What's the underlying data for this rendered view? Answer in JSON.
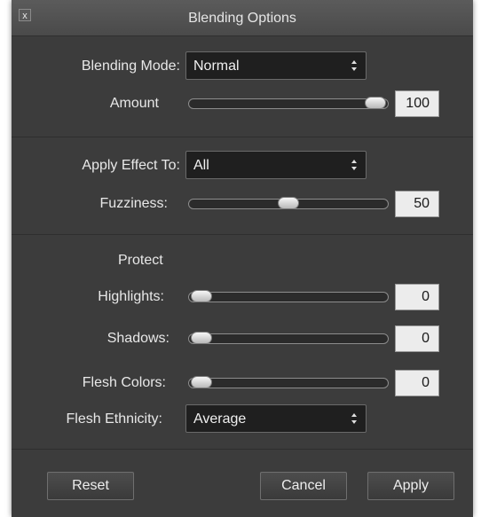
{
  "window": {
    "title": "Blending Options",
    "close_glyph": "x"
  },
  "blending_mode": {
    "label": "Blending Mode:",
    "value": "Normal"
  },
  "amount": {
    "label": "Amount",
    "value": "100",
    "fraction": 1.0
  },
  "apply_effect_to": {
    "label": "Apply Effect To:",
    "value": "All"
  },
  "fuzziness": {
    "label": "Fuzziness:",
    "value": "50",
    "fraction": 0.5
  },
  "protect": {
    "heading": "Protect",
    "highlights": {
      "label": "Highlights:",
      "value": "0",
      "fraction": 0
    },
    "shadows": {
      "label": "Shadows:",
      "value": "0",
      "fraction": 0
    },
    "flesh_colors": {
      "label": "Flesh Colors:",
      "value": "0",
      "fraction": 0
    }
  },
  "flesh_ethnicity": {
    "label": "Flesh Ethnicity:",
    "value": "Average"
  },
  "buttons": {
    "reset": "Reset",
    "cancel": "Cancel",
    "apply": "Apply"
  },
  "colors": {
    "dialog_bg": "#3c3c3c",
    "titlebar_bg": "#4f4f4f",
    "field_bg": "#1f1f1f",
    "numbox_bg": "#ececec"
  },
  "icons": {
    "close": "close-icon",
    "select_arrows": "updown-arrows-icon",
    "slider_thumb": "slider-thumb"
  }
}
